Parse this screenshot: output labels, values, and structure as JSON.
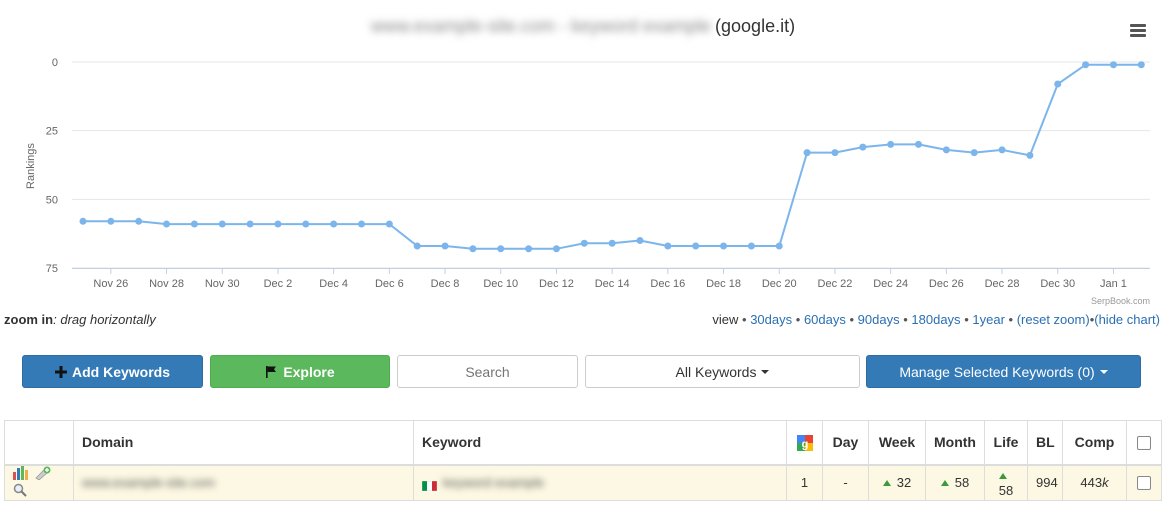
{
  "chart": {
    "title_blurred": "www.example-site.com - keyword example",
    "title_engine": "(google.it)",
    "credit": "SerpBook.com"
  },
  "chart_data": {
    "type": "line",
    "title": "(google.it)",
    "ylabel": "Rankings",
    "ylim": [
      0,
      75
    ],
    "y_reversed": true,
    "yticks": [
      0,
      25,
      50,
      75
    ],
    "xticks": [
      "Nov 26",
      "Nov 28",
      "Nov 30",
      "Dec 2",
      "Dec 4",
      "Dec 6",
      "Dec 8",
      "Dec 10",
      "Dec 12",
      "Dec 14",
      "Dec 16",
      "Dec 18",
      "Dec 20",
      "Dec 22",
      "Dec 24",
      "Dec 26",
      "Dec 28",
      "Dec 30",
      "Jan 1"
    ],
    "x_start": "Nov 25",
    "color": "#7cb5ec",
    "series": [
      {
        "values": [
          58,
          58,
          58,
          59,
          59,
          59,
          59,
          59,
          59,
          59,
          59,
          59,
          67,
          67,
          68,
          68,
          68,
          68,
          66,
          66,
          65,
          67,
          67,
          67,
          67,
          67,
          33,
          33,
          31,
          30,
          30,
          32,
          33,
          32,
          34,
          8,
          1,
          1,
          1
        ]
      }
    ]
  },
  "zoom": {
    "label_bold": "zoom in",
    "label_rest": ": drag horizontally"
  },
  "view": {
    "prefix": "view",
    "links": [
      "30days",
      "60days",
      "90days",
      "180days",
      "1year",
      "(reset zoom)",
      "(hide chart)"
    ]
  },
  "toolbar": {
    "add_label": "Add Keywords",
    "explore_label": "Explore",
    "search_placeholder": "Search",
    "filter_label": "All Keywords",
    "manage_label": "Manage Selected Keywords (0)"
  },
  "table": {
    "headers": {
      "domain": "Domain",
      "keyword": "Keyword",
      "day": "Day",
      "week": "Week",
      "month": "Month",
      "life": "Life",
      "bl": "BL",
      "comp": "Comp"
    },
    "rows": [
      {
        "domain": "www.example-site.com",
        "keyword": "keyword example",
        "rank": "1",
        "day": "-",
        "week": "32",
        "month": "58",
        "life": "58",
        "bl": "994",
        "comp": "443",
        "comp_suffix": "k"
      }
    ]
  },
  "colors": {
    "primary": "#337ab7",
    "success": "#5cb85c",
    "row_highlight": "#fcf8e3",
    "line": "#7cb5ec",
    "trend_up": "#3c9a3c"
  }
}
